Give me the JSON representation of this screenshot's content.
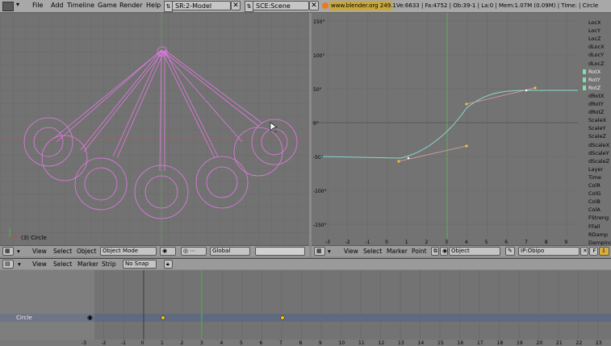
{
  "topbar": {
    "menu": [
      "File",
      "Add",
      "Timeline",
      "Game",
      "Render",
      "Help"
    ],
    "screen_field": "SR:2-Model",
    "scene_field": "SCE:Scene",
    "url": "www.blender.org 249.1",
    "stats": "Ve:6633 | Fa:4752 | Ob:39-1 | La:0 | Mem:1.07M (0.09M) | Time: | Circle"
  },
  "view3d": {
    "object_label": "(3) Circle",
    "header": {
      "view": "View",
      "select": "Select",
      "object": "Object",
      "mode": "Object Mode",
      "orientation": "Global"
    }
  },
  "ipo": {
    "y_ticks": [
      "150°",
      "100°",
      "50°",
      "0°",
      "-50°",
      "-100°",
      "-150°"
    ],
    "x_ticks": [
      "-3",
      "-2",
      "-1",
      "0",
      "1",
      "2",
      "3",
      "4",
      "5",
      "6",
      "7",
      "8",
      "9"
    ],
    "channels": [
      "LocX",
      "LocY",
      "LocZ",
      "dLocX",
      "dLocY",
      "dLocZ",
      "RotX",
      "RotY",
      "RotZ",
      "dRotX",
      "dRotY",
      "dRotZ",
      "ScaleX",
      "ScaleY",
      "ScaleZ",
      "dScaleX",
      "dScaleY",
      "dScaleZ",
      "Layer",
      "Time",
      "ColR",
      "ColG",
      "ColB",
      "ColA",
      "FStreng",
      "FFall",
      "RDamp",
      "Damping"
    ],
    "active_channels": [
      "RotX",
      "RotY",
      "RotZ"
    ],
    "header": {
      "view": "View",
      "select": "Select",
      "marker": "Marker",
      "point": "Point",
      "object": "Object",
      "ipo_name": "IP:Obipo",
      "f_button": "F"
    },
    "colors": {
      "curve": "#8ad8d0",
      "handle": "#e0a0a0"
    }
  },
  "action": {
    "header": {
      "view": "View",
      "select": "Select",
      "marker": "Marker",
      "strip": "Strip",
      "snap": "No Snap"
    },
    "channel": "Circle",
    "x_ticks": [
      "-3",
      "-2",
      "-1",
      "0",
      "1",
      "2",
      "3",
      "4",
      "5",
      "6",
      "7",
      "8",
      "9",
      "10",
      "11",
      "12",
      "13",
      "14",
      "15",
      "16",
      "17",
      "18",
      "19",
      "20",
      "21",
      "22",
      "23"
    ]
  }
}
